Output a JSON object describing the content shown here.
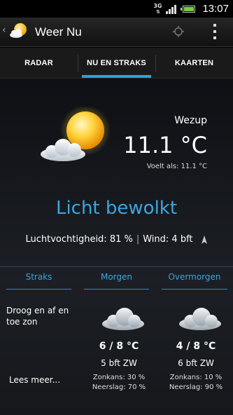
{
  "statusbar": {
    "network": "3G",
    "time": "13:07"
  },
  "app": {
    "title": "Weer Nu"
  },
  "tabs": [
    {
      "label": "RADAR"
    },
    {
      "label": "NU EN STRAKS",
      "active": true
    },
    {
      "label": "KAARTEN"
    }
  ],
  "current": {
    "location": "Wezup",
    "temperature": "11.1 °C",
    "feels_like": "Voelt als: 11.1 °C",
    "condition": "Licht bewolkt",
    "humidity": "Luchtvochtigheid: 81 %",
    "separator": "|",
    "wind": "Wind: 4 bft",
    "icon": "sun-with-cloud-icon"
  },
  "forecast": {
    "straks": {
      "header": "Straks",
      "text": "Droog en af en toe zon",
      "more_link": "Lees meer..."
    },
    "days": [
      {
        "header": "Morgen",
        "icon": "cloud-icon",
        "temp": "6 / 8 °C",
        "wind": "5 bft  ZW",
        "sun": "Zonkans: 30 %",
        "rain": "Neerslag: 70 %"
      },
      {
        "header": "Overmorgen",
        "icon": "cloud-icon",
        "temp": "4 / 8 °C",
        "wind": "6 bft  ZW",
        "sun": "Zonkans: 10 %",
        "rain": "Neerslag: 90 %"
      }
    ]
  },
  "colors": {
    "accent": "#3aa6df",
    "tab_indicator": "#2aa3d6",
    "battery": "#6fd33a"
  }
}
